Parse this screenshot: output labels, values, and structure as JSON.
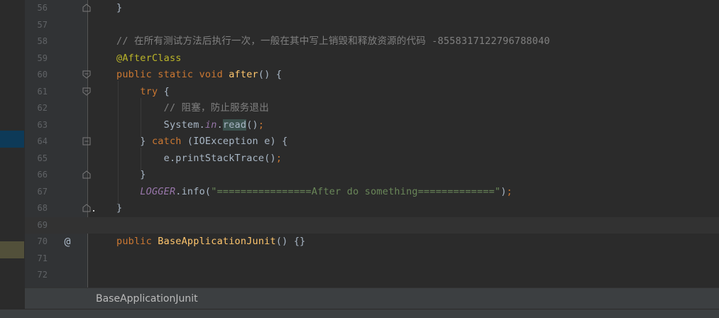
{
  "editor": {
    "lines": [
      {
        "num": "56",
        "tokens": [
          {
            "t": "}",
            "c": ""
          }
        ]
      },
      {
        "num": "57",
        "tokens": []
      },
      {
        "num": "58",
        "tokens": [
          {
            "t": "// 在所有测试方法后执行一次，一般在其中写上销毁和释放资源的代码 -8558317122796788040",
            "c": "cmt"
          }
        ]
      },
      {
        "num": "59",
        "tokens": [
          {
            "t": "@AfterClass",
            "c": "ann"
          }
        ]
      },
      {
        "num": "60",
        "tokens": [
          {
            "t": "public static void ",
            "c": "kw"
          },
          {
            "t": "after",
            "c": "fn"
          },
          {
            "t": "() {",
            "c": ""
          }
        ]
      },
      {
        "num": "61",
        "tokens": [
          {
            "t": "    ",
            "c": ""
          },
          {
            "t": "try",
            "c": "kw"
          },
          {
            "t": " {",
            "c": ""
          }
        ]
      },
      {
        "num": "62",
        "tokens": [
          {
            "t": "        ",
            "c": ""
          },
          {
            "t": "// 阻塞，防止服务退出",
            "c": "cmt"
          }
        ]
      },
      {
        "num": "63",
        "tokens": [
          {
            "t": "        System.",
            "c": ""
          },
          {
            "t": "in",
            "c": "ital"
          },
          {
            "t": ".",
            "c": ""
          },
          {
            "t": "read",
            "c": "hl"
          },
          {
            "t": "()",
            "c": ""
          },
          {
            "t": ";",
            "c": "kw"
          }
        ]
      },
      {
        "num": "64",
        "tokens": [
          {
            "t": "    } ",
            "c": ""
          },
          {
            "t": "catch",
            "c": "kw"
          },
          {
            "t": " (IOException e) {",
            "c": ""
          }
        ]
      },
      {
        "num": "65",
        "tokens": [
          {
            "t": "        e.printStackTrace()",
            "c": ""
          },
          {
            "t": ";",
            "c": "kw"
          }
        ]
      },
      {
        "num": "66",
        "tokens": [
          {
            "t": "    }",
            "c": ""
          }
        ]
      },
      {
        "num": "67",
        "tokens": [
          {
            "t": "    ",
            "c": ""
          },
          {
            "t": "LOGGER",
            "c": "ital"
          },
          {
            "t": ".info(",
            "c": ""
          },
          {
            "t": "\"================After do something=============\"",
            "c": "str"
          },
          {
            "t": ")",
            "c": ""
          },
          {
            "t": ";",
            "c": "kw"
          }
        ]
      },
      {
        "num": "68",
        "tokens": [
          {
            "t": "}",
            "c": ""
          }
        ]
      },
      {
        "num": "69",
        "tokens": []
      },
      {
        "num": "70",
        "tokens": [
          {
            "t": "public ",
            "c": "kw"
          },
          {
            "t": "BaseApplicationJunit",
            "c": "fn"
          },
          {
            "t": "() {}",
            "c": ""
          }
        ]
      },
      {
        "num": "71",
        "tokens": []
      },
      {
        "num": "72",
        "tokens": []
      }
    ],
    "current_line": "69",
    "gutter_icons": [
      {
        "line": "70",
        "name": "at-icon",
        "glyph": "@"
      }
    ]
  },
  "breadcrumb": {
    "label": "BaseApplicationJunit"
  },
  "colors": {
    "background": "#2b2b2b",
    "gutter": "#313335",
    "keyword": "#cc7832",
    "annotation": "#bbb529",
    "method": "#ffc66d",
    "comment": "#808080",
    "string": "#6a8759",
    "static_field": "#9876aa",
    "text": "#a9b7c6"
  }
}
